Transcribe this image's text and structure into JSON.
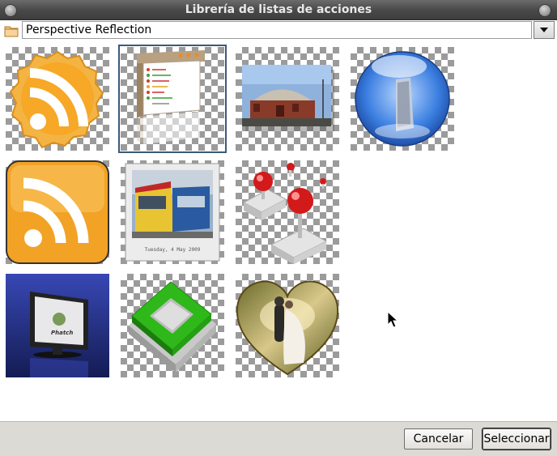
{
  "window": {
    "title": "Librería de listas de acciones"
  },
  "path": {
    "value": "Perspective Reflection"
  },
  "thumbnails": [
    {
      "name": "rss-badge-orange",
      "selected": false
    },
    {
      "name": "app-window-perspective",
      "selected": true
    },
    {
      "name": "building-photo-shadow",
      "selected": false
    },
    {
      "name": "blue-glass-sphere",
      "selected": false
    },
    {
      "name": "rss-rounded-square",
      "selected": false
    },
    {
      "name": "tram-polaroid",
      "selected": false,
      "caption": "Tuesday, 4 May 2009"
    },
    {
      "name": "red-joysticks",
      "selected": false
    },
    {
      "name": "monitor-photo",
      "selected": false,
      "screen_text": "Phatch"
    },
    {
      "name": "green-square-frame",
      "selected": false
    },
    {
      "name": "heart-wedding-photo",
      "selected": false
    }
  ],
  "buttons": {
    "cancel": "Cancelar",
    "select": "Seleccionar"
  }
}
